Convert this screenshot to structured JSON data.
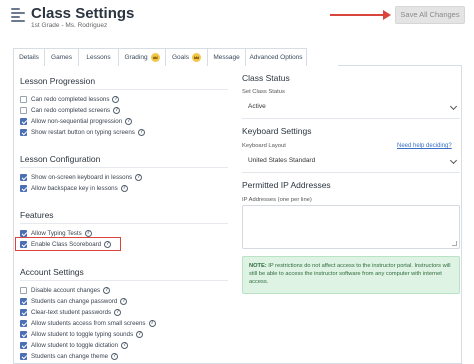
{
  "header": {
    "title": "Class Settings",
    "subtitle": "1st Grade - Ms. Rodriguez",
    "save_label": "Save All Changes"
  },
  "tabs": [
    {
      "label": "Details",
      "crown": false
    },
    {
      "label": "Games",
      "crown": false
    },
    {
      "label": "Lessons",
      "crown": false
    },
    {
      "label": "Grading",
      "crown": true
    },
    {
      "label": "Goals",
      "crown": true
    },
    {
      "label": "Message",
      "crown": false
    },
    {
      "label": "Advanced Options",
      "crown": false,
      "active": true
    }
  ],
  "lesson_progression": {
    "title": "Lesson Progression",
    "items": [
      {
        "label": "Can redo completed lessons",
        "checked": false,
        "help": true
      },
      {
        "label": "Can redo completed screens",
        "checked": false,
        "help": true
      },
      {
        "label": "Allow non-sequential progression",
        "checked": true,
        "help": true
      },
      {
        "label": "Show restart button on typing screens",
        "checked": true,
        "help": true
      }
    ]
  },
  "lesson_configuration": {
    "title": "Lesson Configuration",
    "items": [
      {
        "label": "Show on-screen keyboard in lessons",
        "checked": true,
        "help": true
      },
      {
        "label": "Allow backspace key in lessons",
        "checked": true,
        "help": true
      }
    ]
  },
  "features": {
    "title": "Features",
    "items": [
      {
        "label": "Allow Typing Tests",
        "checked": true,
        "help": true
      },
      {
        "label": "Enable Class Scoreboard",
        "checked": true,
        "help": true
      }
    ]
  },
  "account_settings": {
    "title": "Account Settings",
    "items": [
      {
        "label": "Disable account changes",
        "checked": false,
        "help": true
      },
      {
        "label": "Students can change password",
        "checked": true,
        "help": true
      },
      {
        "label": "Clear-text student passwords",
        "checked": true,
        "help": true
      },
      {
        "label": "Allow students access from small screens",
        "checked": true,
        "help": true
      },
      {
        "label": "Allow student to toggle typing sounds",
        "checked": true,
        "help": true
      },
      {
        "label": "Allow student to toggle dictation",
        "checked": true,
        "help": true
      },
      {
        "label": "Students can change theme",
        "checked": true,
        "help": true
      }
    ]
  },
  "class_status": {
    "title": "Class Status",
    "field_label": "Set Class Status",
    "value": "Active"
  },
  "keyboard_settings": {
    "title": "Keyboard Settings",
    "field_label": "Keyboard Layout",
    "help_link": "Need help deciding?",
    "value": "United States Standard"
  },
  "permitted_ip": {
    "title": "Permitted IP Addresses",
    "field_label": "IP Addresses (one per line)",
    "value": "",
    "note_bold": "NOTE:",
    "note_text": " IP restrictions do not affect access to the instructor portal. Instructors will still be able to access the instructor software from any computer with internet access."
  },
  "icons": {
    "header": "list-icon",
    "help": "question-circle-icon",
    "premium": "crown-icon"
  },
  "colors": {
    "accent_check": "#4a6fb5",
    "highlight": "#d9443c",
    "note_bg": "#dff3e4",
    "link": "#3b6fc6"
  }
}
